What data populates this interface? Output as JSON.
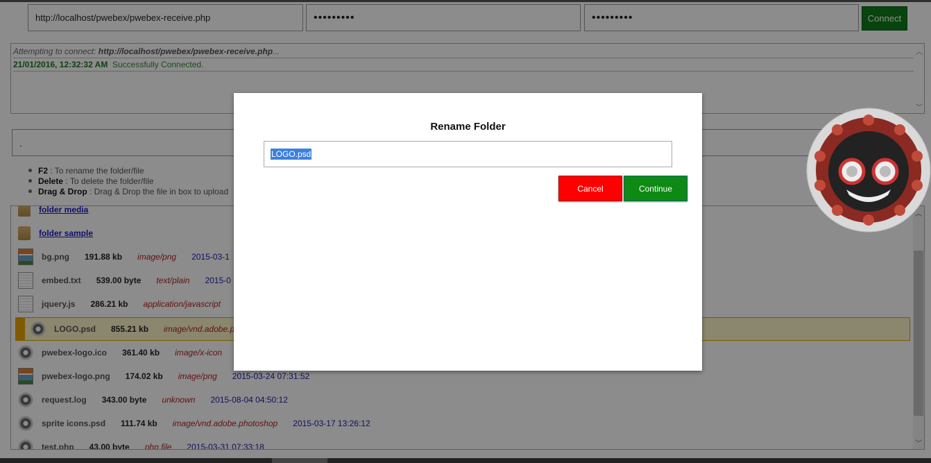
{
  "connection": {
    "url_value": "http://localhost/pwebex/pwebex-receive.php",
    "password1_value": "•••••••••",
    "password2_value": "•••••••••",
    "connect_label": "Connect"
  },
  "log": {
    "attempt_prefix": "Attempting to connect: ",
    "attempt_url": "http://localhost/pwebex/pwebex-receive.php",
    "attempt_suffix": "...",
    "timestamp": "21/01/2016, 12:32:32 AM",
    "status": "Successfully Connected."
  },
  "path": {
    "value": "."
  },
  "help": [
    {
      "key": "F2",
      "text": " : To rename the folder/file"
    },
    {
      "key": "Delete",
      "text": " : To delete the folder/file"
    },
    {
      "key": "Drag & Drop",
      "text": " : Drag & Drop the file in box to upload"
    }
  ],
  "files": [
    {
      "name": "folder media",
      "icon": "folder-icon"
    },
    {
      "name": "folder sample",
      "icon": "folder-icon"
    },
    {
      "name": "bg.png",
      "size": "191.88 kb",
      "mime": "image/png",
      "date": "2015-03-1",
      "icon": "image-file-icon"
    },
    {
      "name": "embed.txt",
      "size": "539.00 byte",
      "mime": "text/plain",
      "date": "2015-0",
      "icon": "text-file-icon"
    },
    {
      "name": "jquery.js",
      "size": "286.21 kb",
      "mime": "application/javascript",
      "date": "",
      "icon": "text-file-icon"
    },
    {
      "name": "LOGO.psd",
      "size": "855.21 kb",
      "mime": "image/vnd.adobe.p",
      "date": "",
      "icon": "gear-file-icon"
    },
    {
      "name": "pwebex-logo.ico",
      "size": "361.40 kb",
      "mime": "image/x-icon",
      "date": "",
      "icon": "gear-file-icon"
    },
    {
      "name": "pwebex-logo.png",
      "size": "174.02 kb",
      "mime": "image/png",
      "date": "2015-03-24 07:31:52",
      "icon": "image-file-icon"
    },
    {
      "name": "request.log",
      "size": "343.00 byte",
      "mime": "unknown",
      "date": "2015-08-04 04:50:12",
      "icon": "gear-file-icon"
    },
    {
      "name": "sprite icons.psd",
      "size": "111.74 kb",
      "mime": "image/vnd.adobe.photoshop",
      "date": "2015-03-17 13:26:12",
      "icon": "gear-file-icon"
    },
    {
      "name": "test.php",
      "size": "43.00 byte",
      "mime": "php file",
      "date": "2015-03-31 07:33:18",
      "icon": "php-file-icon"
    }
  ],
  "modal": {
    "title": "Rename Folder",
    "input_value": "LOGO.psd",
    "cancel_label": "Cancel",
    "continue_label": "Continue"
  }
}
